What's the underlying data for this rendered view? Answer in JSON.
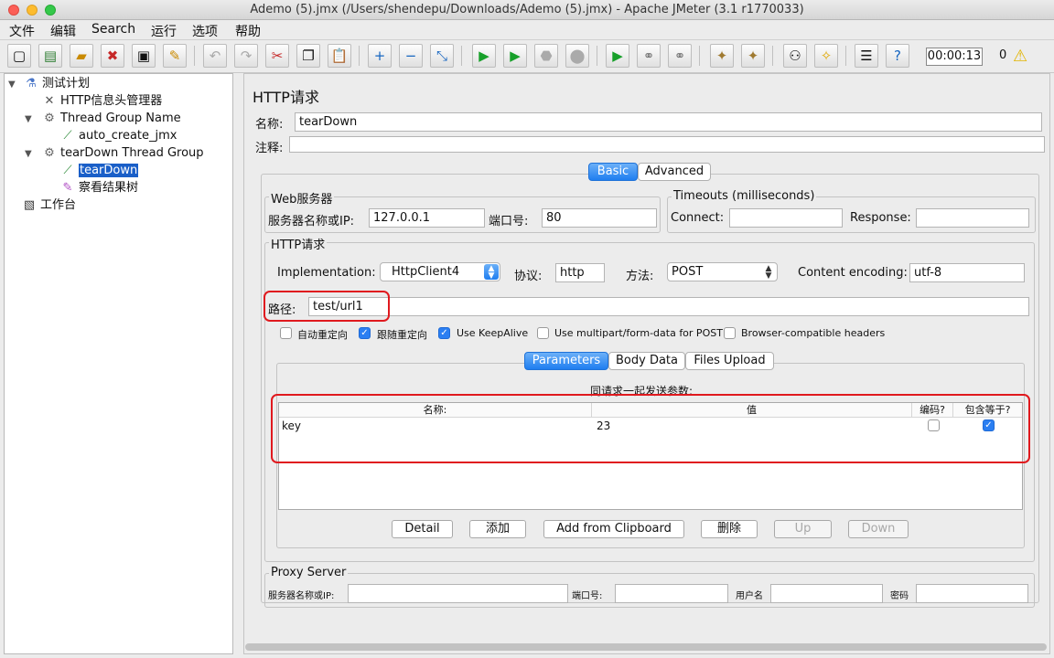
{
  "window": {
    "title": "Ademo (5).jmx (/Users/shendepu/Downloads/Ademo (5).jmx) - Apache JMeter (3.1 r1770033)"
  },
  "menu": [
    "文件",
    "编辑",
    "Search",
    "运行",
    "选项",
    "帮助"
  ],
  "toolbar": {
    "timer": "00:00:13",
    "error_count": "0"
  },
  "tree": {
    "items": [
      {
        "label": "测试计划",
        "icon": "flask-icon"
      },
      {
        "label": "HTTP信息头管理器",
        "icon": "tools-icon"
      },
      {
        "label": "Thread Group Name",
        "icon": "gear-icon"
      },
      {
        "label": "auto_create_jmx",
        "icon": "pipette-icon"
      },
      {
        "label": "tearDown Thread Group",
        "icon": "gear-icon"
      },
      {
        "label": "tearDown",
        "icon": "pipette-icon"
      },
      {
        "label": "察看结果树",
        "icon": "chart-icon"
      },
      {
        "label": "工作台",
        "icon": "workbench-icon"
      }
    ]
  },
  "panel": {
    "title": "HTTP请求",
    "name_label": "名称:",
    "name_value": "tearDown",
    "comment_label": "注释:",
    "comment_value": "",
    "tabs": [
      "Basic",
      "Advanced"
    ],
    "web_server": {
      "title": "Web服务器",
      "server_label": "服务器名称或IP:",
      "server_value": "127.0.0.1",
      "port_label": "端口号:",
      "port_value": "80"
    },
    "timeouts": {
      "title": "Timeouts (milliseconds)",
      "connect_label": "Connect:",
      "connect_value": "",
      "response_label": "Response:",
      "response_value": ""
    },
    "http": {
      "title": "HTTP请求",
      "impl_label": "Implementation:",
      "impl_value": "HttpClient4",
      "protocol_label": "协议:",
      "protocol_value": "http",
      "method_label": "方法:",
      "method_value": "POST",
      "encoding_label": "Content encoding:",
      "encoding_value": "utf-8",
      "path_label": "路径:",
      "path_value": "test/url1",
      "checkboxes": [
        {
          "label": "自动重定向",
          "checked": false
        },
        {
          "label": "跟随重定向",
          "checked": true
        },
        {
          "label": "Use KeepAlive",
          "checked": true
        },
        {
          "label": "Use multipart/form-data for POST",
          "checked": false
        },
        {
          "label": "Browser-compatible headers",
          "checked": false
        }
      ],
      "subtabs": [
        "Parameters",
        "Body Data",
        "Files Upload"
      ],
      "params_caption": "同请求一起发送参数:",
      "columns": [
        "名称:",
        "值",
        "编码?",
        "包含等于?"
      ],
      "rows": [
        {
          "name": "key",
          "value": "23",
          "encode": false,
          "include_equals": true
        }
      ],
      "buttons": [
        "Detail",
        "添加",
        "Add from Clipboard",
        "删除",
        "Up",
        "Down"
      ]
    },
    "proxy": {
      "title": "Proxy Server",
      "server_label": "服务器名称或IP:",
      "port_label": "端口号:",
      "user_label": "用户名",
      "password_label": "密码"
    }
  }
}
